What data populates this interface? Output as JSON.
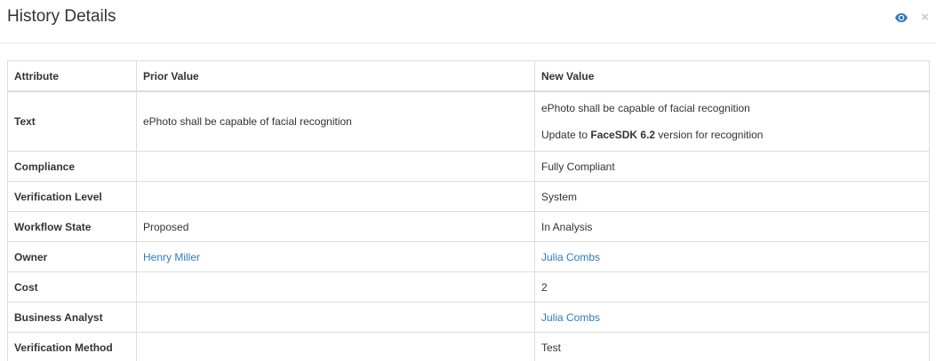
{
  "dialog": {
    "title": "History Details",
    "eye_icon": "eye-icon",
    "close_icon": "close-icon",
    "close_glyph": "×",
    "colors": {
      "accent": "#337ab7",
      "link": "#337ab7",
      "border": "#dddddd",
      "text": "#333333",
      "close": "#c8c8c8"
    }
  },
  "table": {
    "headers": {
      "attribute": "Attribute",
      "prior": "Prior Value",
      "new": "New Value"
    },
    "rows": [
      {
        "attribute": "Text",
        "prior": "ePhoto shall be capable of facial recognition",
        "new_line1": "ePhoto shall be capable of facial recognition",
        "new_line2_prefix": "Update to ",
        "new_line2_bold": "FaceSDK 6.2",
        "new_line2_suffix": " version for recognition"
      },
      {
        "attribute": "Compliance",
        "prior": "",
        "new": "Fully Compliant"
      },
      {
        "attribute": "Verification Level",
        "prior": "",
        "new": "System"
      },
      {
        "attribute": "Workflow State",
        "prior": "Proposed",
        "new": "In Analysis"
      },
      {
        "attribute": "Owner",
        "prior": "Henry Miller",
        "new": "Julia Combs"
      },
      {
        "attribute": "Cost",
        "prior": "",
        "new": "2"
      },
      {
        "attribute": "Business Analyst",
        "prior": "",
        "new": "Julia Combs"
      },
      {
        "attribute": "Verification Method",
        "prior": "",
        "new": "Test"
      }
    ]
  }
}
